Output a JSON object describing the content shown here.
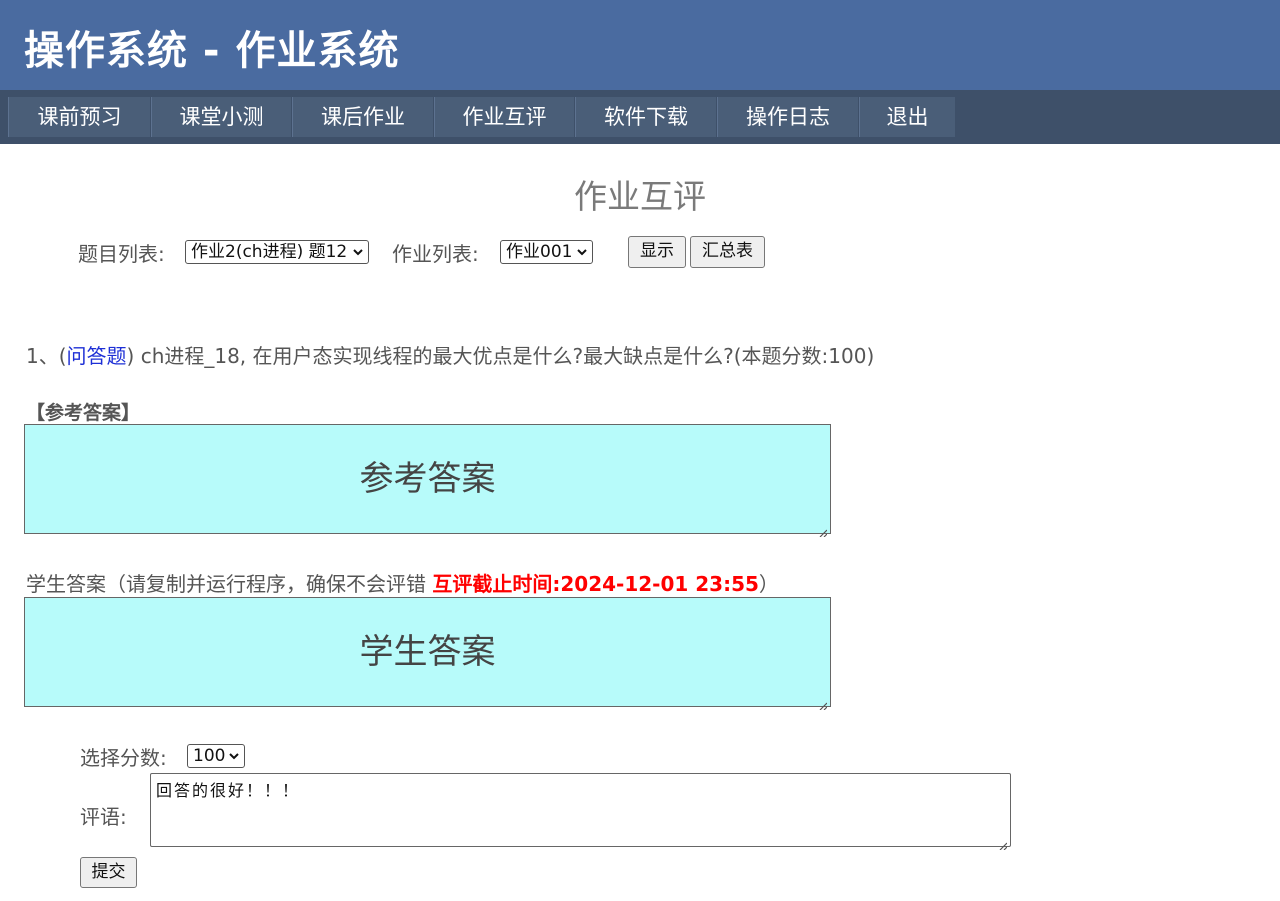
{
  "header": {
    "title": "操作系统 - 作业系统"
  },
  "nav": {
    "items": [
      {
        "label": "课前预习"
      },
      {
        "label": "课堂小测"
      },
      {
        "label": "课后作业"
      },
      {
        "label": "作业互评"
      },
      {
        "label": "软件下载"
      },
      {
        "label": "操作日志"
      },
      {
        "label": "退出"
      }
    ]
  },
  "main": {
    "title": "作业互评",
    "filters": {
      "topic_label": "题目列表:",
      "topic_value": "作业2(ch进程) 题12",
      "assignment_label": "作业列表:",
      "assignment_value": "作业001",
      "show_button": "显示",
      "summary_button": "汇总表"
    },
    "question": {
      "prefix": "1、(",
      "type": "问答题",
      "text": ") ch进程_18, 在用户态实现线程的最大优点是什么?最大缺点是什么?(本题分数:100)"
    },
    "reference": {
      "heading": "【参考答案】",
      "placeholder": "参考答案"
    },
    "student": {
      "label": "学生答案（请复制并运行程序，确保不会评错 ",
      "deadline": "互评截止时间:2024-12-01 23:55",
      "suffix": "）",
      "placeholder": "学生答案"
    },
    "grading": {
      "score_label": "选择分数:",
      "score_value": "100",
      "comment_label": "评语:",
      "comment_value": "回答的很好！！！",
      "submit_label": "提交"
    }
  }
}
